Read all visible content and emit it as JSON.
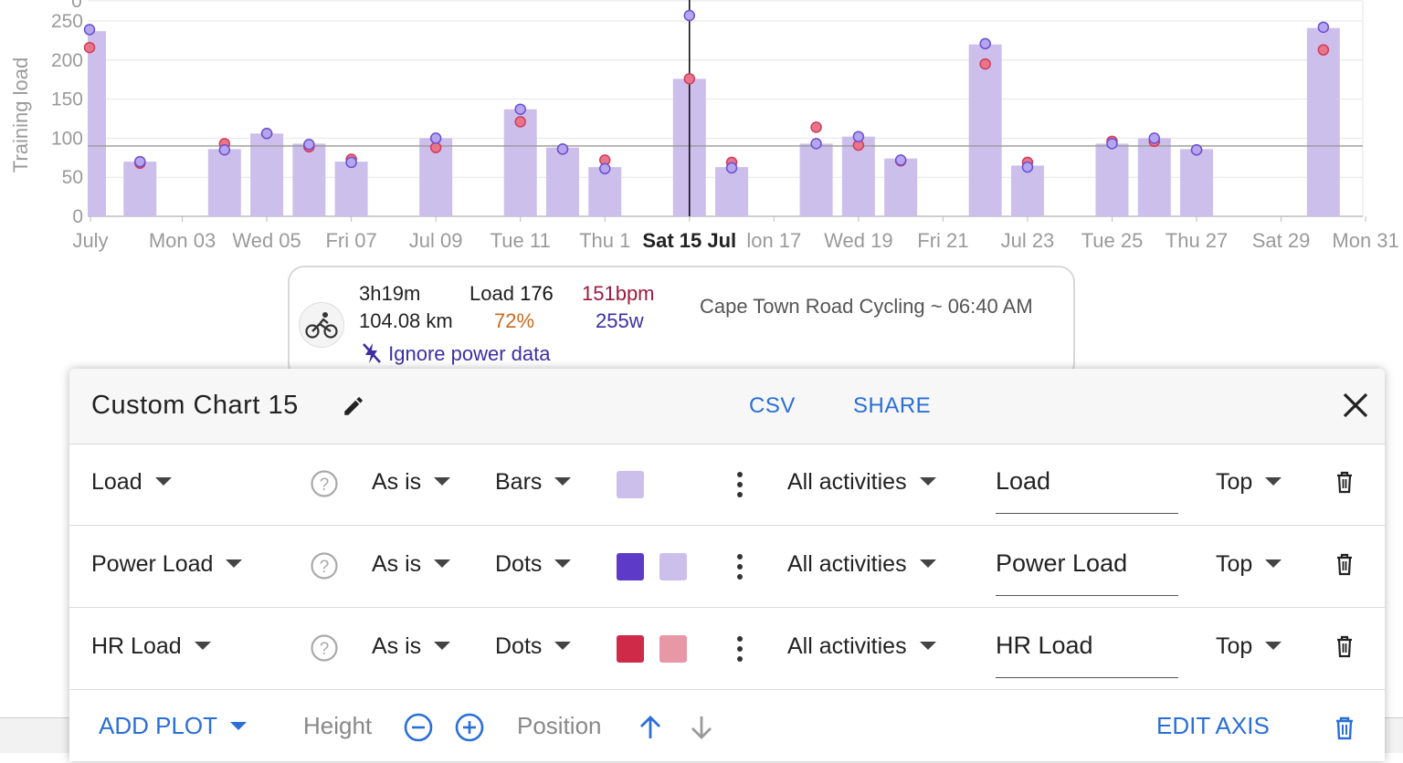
{
  "chart": {
    "ylabel": "Training load",
    "y_ticks": [
      "0",
      "50",
      "100",
      "150",
      "200",
      "250"
    ],
    "top_tick": "0",
    "x_ticks": [
      "July",
      "Mon 03",
      "Wed 05",
      "Fri 07",
      "Jul 09",
      "Tue 11",
      "Thu 1",
      "Sat 15 Jul",
      "lon 17",
      "Wed 19",
      "Fri 21",
      "Jul 23",
      "Tue 25",
      "Thu 27",
      "Sat 29",
      "Mon 31"
    ],
    "colors": {
      "bars": "#cdbfec",
      "power_dots": "#6a4fd4",
      "hr_dots": "#d23d5a",
      "grid": "#e6e6e6",
      "refline": "#999999"
    }
  },
  "chart_data": {
    "type": "bar",
    "ylabel": "Training load",
    "ylim": [
      0,
      250
    ],
    "reference_line": 90,
    "x": [
      "Jul 01",
      "Jul 02",
      "Jul 04",
      "Jul 05",
      "Jul 06",
      "Jul 07",
      "Jul 09",
      "Jul 11",
      "Jul 12",
      "Jul 13",
      "Jul 15",
      "Jul 16",
      "Jul 18",
      "Jul 19",
      "Jul 20",
      "Jul 22",
      "Jul 23",
      "Jul 25",
      "Jul 26",
      "Jul 27",
      "Jul 30"
    ],
    "series": [
      {
        "name": "Load",
        "kind": "bars",
        "values": [
          237,
          70,
          86,
          106,
          93,
          70,
          100,
          137,
          88,
          63,
          176,
          63,
          93,
          102,
          74,
          220,
          65,
          93,
          100,
          86,
          241
        ]
      },
      {
        "name": "Power Load",
        "kind": "dots",
        "values": [
          239,
          70,
          85,
          106,
          92,
          69,
          100,
          137,
          86,
          61,
          257,
          62,
          93,
          102,
          72,
          221,
          63,
          93,
          100,
          85,
          242
        ]
      },
      {
        "name": "HR Load",
        "kind": "dots",
        "values": [
          216,
          68,
          93,
          106,
          89,
          73,
          88,
          121,
          86,
          72,
          176,
          69,
          114,
          91,
          71,
          195,
          69,
          96,
          96,
          85,
          213
        ]
      }
    ]
  },
  "tooltip": {
    "duration": "3h19m",
    "distance": "104.08 km",
    "load_label": "Load",
    "load_value": "176",
    "intensity": "72%",
    "heart_rate": "151bpm",
    "power": "255w",
    "activity": "Cape Town Road Cycling ~ 06:40 AM",
    "ignore_power": "Ignore power data",
    "colors": {
      "intensity": "#c86a1e",
      "heart_rate": "#9b1a3c",
      "power": "#3d2fa3",
      "link": "#3d2fa3"
    }
  },
  "panel": {
    "title": "Custom Chart 15",
    "csv": "CSV",
    "share": "SHARE",
    "rows": [
      {
        "field": "Load",
        "transform": "As is",
        "type": "Bars",
        "colors": [
          "#cdbfec"
        ],
        "filter": "All activities",
        "name": "Load",
        "position": "Top"
      },
      {
        "field": "Power Load",
        "transform": "As is",
        "type": "Dots",
        "colors": [
          "#5d3ac8",
          "#cdbfec"
        ],
        "filter": "All activities",
        "name": "Power Load",
        "position": "Top"
      },
      {
        "field": "HR Load",
        "transform": "As is",
        "type": "Dots",
        "colors": [
          "#cf2a48",
          "#e897a6"
        ],
        "filter": "All activities",
        "name": "HR Load",
        "position": "Top"
      }
    ],
    "footer": {
      "add_plot": "ADD PLOT",
      "height": "Height",
      "position": "Position",
      "edit_axis": "EDIT AXIS"
    }
  }
}
